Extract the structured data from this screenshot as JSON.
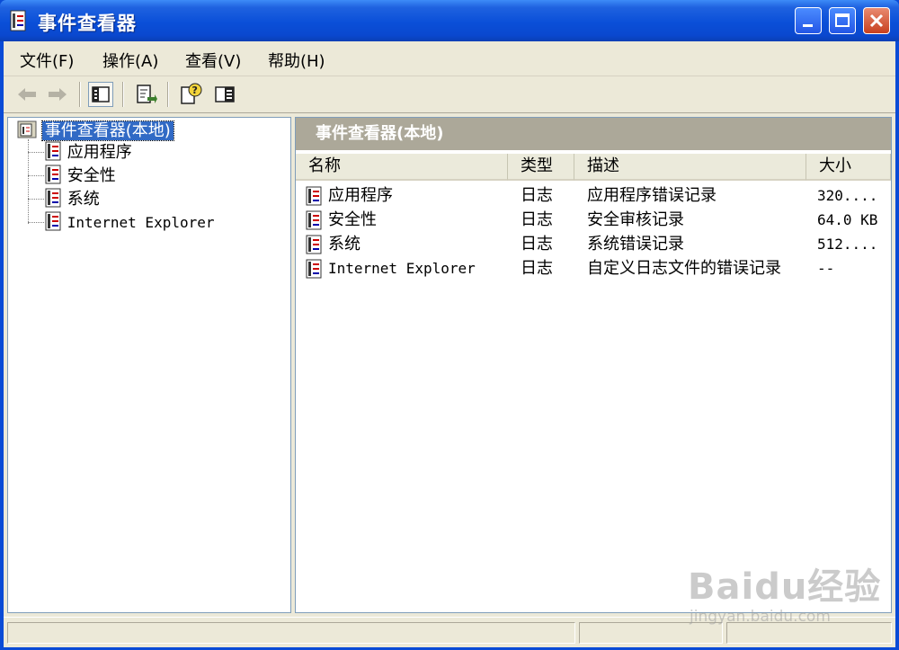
{
  "window": {
    "title": "事件查看器"
  },
  "menu": [
    "文件(F)",
    "操作(A)",
    "查看(V)",
    "帮助(H)"
  ],
  "toolbar": [
    "back-arrow-icon",
    "forward-arrow-icon",
    "show-hide-tree-icon",
    "export-list-icon",
    "help-icon",
    "console-pane-icon"
  ],
  "tree": {
    "root": "事件查看器(本地)",
    "children": [
      "应用程序",
      "安全性",
      "系统",
      "Internet Explorer"
    ]
  },
  "panel": {
    "header": "事件查看器(本地)",
    "columns": [
      "名称",
      "类型",
      "描述",
      "大小"
    ],
    "rows": [
      {
        "name": "应用程序",
        "type": "日志",
        "desc": "应用程序错误记录",
        "size": "320...."
      },
      {
        "name": "安全性",
        "type": "日志",
        "desc": "安全审核记录",
        "size": "64.0 KB"
      },
      {
        "name": "系统",
        "type": "日志",
        "desc": "系统错误记录",
        "size": "512...."
      },
      {
        "name": "Internet Explorer",
        "type": "日志",
        "desc": "自定义日志文件的错误记录",
        "size": "--"
      }
    ]
  },
  "watermark": {
    "logo": "Baidu经验",
    "sub": "jingyan.baidu.com"
  },
  "colors": {
    "titlebar": "#0a4fd8",
    "selection": "#316ac5",
    "pane_header": "#aca899",
    "chrome": "#ece9d8"
  }
}
